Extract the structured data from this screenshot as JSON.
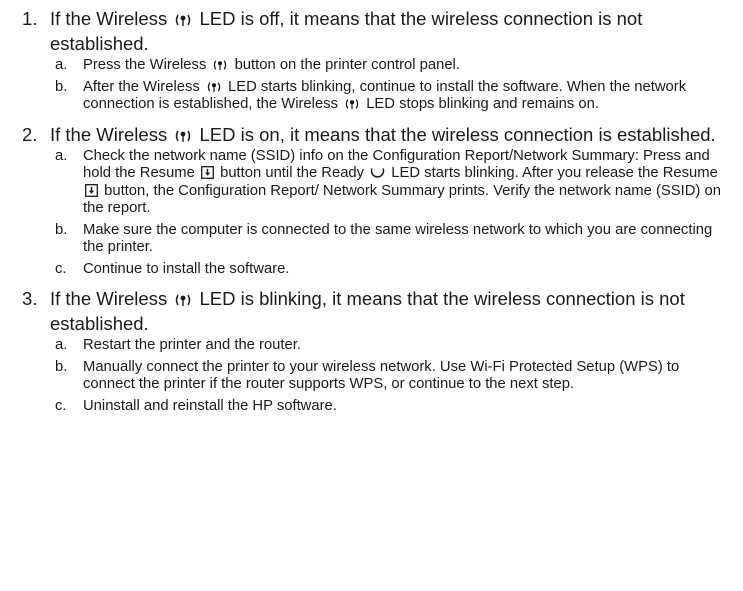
{
  "steps": [
    {
      "number": "1.",
      "segments": [
        "If the Wireless ",
        " LED is off, it means that the wireless connection is not established."
      ],
      "subs": [
        {
          "letter": "a.",
          "segments": [
            "Press the Wireless ",
            " button on the printer control panel."
          ]
        },
        {
          "letter": "b.",
          "segments": [
            "After the Wireless ",
            " LED starts blinking, continue to install the software. When the network connection is established, the Wireless ",
            " LED stops blinking and remains on."
          ]
        }
      ]
    },
    {
      "number": "2.",
      "segments": [
        "If the Wireless ",
        " LED is on, it means that the wireless connection is established."
      ],
      "subs": [
        {
          "letter": "a.",
          "segments": [
            "Check the network name (SSID) info on the Configuration Report/Network Summary: Press and hold the Resume ",
            " button until the Ready ",
            " LED starts blinking. After you release the Resume ",
            " button, the Configuration Report/ Network Summary prints. Verify the network name (SSID) on the report."
          ]
        },
        {
          "letter": "b.",
          "text": "Make sure the computer is connected to the same wireless network to which you are connecting the printer."
        },
        {
          "letter": "c.",
          "text": "Continue to install the software."
        }
      ]
    },
    {
      "number": "3.",
      "segments": [
        "If the Wireless ",
        " LED is blinking, it means that the wireless connection is not established."
      ],
      "subs": [
        {
          "letter": "a.",
          "text": "Restart the printer and the router."
        },
        {
          "letter": "b.",
          "text": "Manually connect the printer to your wireless network. Use Wi-Fi Protected Setup (WPS) to connect the printer if the router supports WPS, or continue to the next step."
        },
        {
          "letter": "c.",
          "text": "Uninstall and reinstall the HP software."
        }
      ]
    }
  ],
  "icons": {
    "wireless": "wireless-icon",
    "resume": "resume-icon",
    "ready": "ready-icon"
  }
}
